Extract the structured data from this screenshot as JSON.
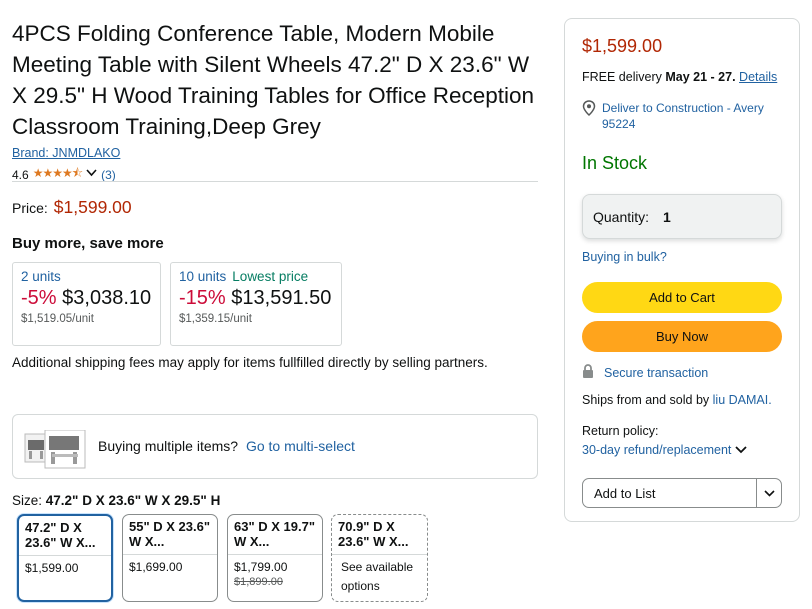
{
  "product": {
    "title": "4PCS Folding Conference Table, Modern Mobile Meeting Table with Silent Wheels 47.2\" D X 23.6\" W X 29.5\" H Wood Training Tables for Office Reception Classroom Training,Deep Grey",
    "brand": "Brand: JNMDLAKO",
    "rating": "4.6",
    "review_count": "(3)",
    "price_label": "Price:",
    "price": "$1,599.00"
  },
  "bulk": {
    "title": "Buy more, save more",
    "tiers": [
      {
        "units": "2 units",
        "badge": "",
        "pct": "-5%",
        "price": "$3,038.10",
        "unit_price": "$1,519.05/unit"
      },
      {
        "units": "10 units",
        "badge": "Lowest price",
        "pct": "-15%",
        "price": "$13,591.50",
        "unit_price": "$1,359.15/unit"
      }
    ]
  },
  "shipping_note": "Additional shipping fees may apply for items fullfilled directly by selling partners.",
  "multi_select": {
    "text": "Buying multiple items?",
    "link": "Go to multi-select"
  },
  "size": {
    "label": "Size:",
    "selected": "47.2\" D X 23.6\" W X 29.5\" H",
    "options": [
      {
        "name": "47.2\" D X 23.6\" W X...",
        "price": "$1,599.00",
        "old_price": "",
        "selected": true
      },
      {
        "name": "55\" D X 23.6\" W X...",
        "price": "$1,699.00",
        "old_price": "",
        "selected": false
      },
      {
        "name": "63\" D X 19.7\" W X...",
        "price": "$1,799.00",
        "old_price": "$1,899.00",
        "selected": false
      },
      {
        "name": "70.9\" D X 23.6\" W X...",
        "price": "",
        "old_price": "",
        "see": "See available options",
        "selected": false
      }
    ]
  },
  "buybox": {
    "price": "$1,599.00",
    "delivery_prefix": "FREE delivery",
    "delivery_date": "May 21 - 27.",
    "delivery_link": "Details",
    "location": "Deliver to Construction - Avery 95224",
    "stock": "In Stock",
    "quantity_label": "Quantity:",
    "quantity_value": "1",
    "bulk_link": "Buying in bulk?",
    "add_to_cart": "Add to Cart",
    "buy_now": "Buy Now",
    "secure": "Secure transaction",
    "ships_from_prefix": "Ships from and sold by",
    "seller": "liu DAMAI.",
    "returns_label": "Return policy:",
    "returns_link": "30-day refund/replacement",
    "add_to_list": "Add to List"
  },
  "colors": {
    "link": "#2162a1",
    "price": "#b12704",
    "in_stock": "#007600",
    "add_to_cart": "#ffd814",
    "buy_now": "#ffa41c",
    "discount": "#cc0c39"
  }
}
